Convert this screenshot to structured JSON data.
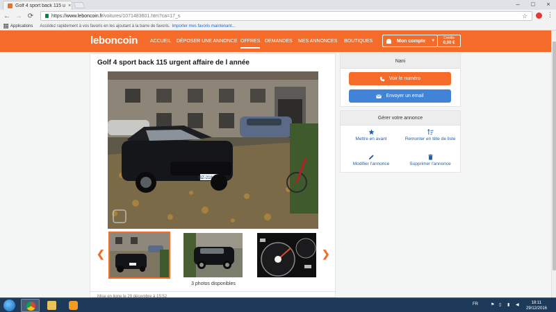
{
  "browser": {
    "tab_title": "Golf 4 sport back 115 ur",
    "tab_close": "×",
    "window_controls": [
      "–",
      "□",
      "×"
    ],
    "nav": {
      "back": "←",
      "forward": "→",
      "reload": "⟳",
      "home": "⌂"
    },
    "url_prefix": "https://",
    "url_host": "www.leboncoin.fr",
    "url_path": "/voitures/1071483601.htm?ca=17_s",
    "star": "☆",
    "menu": "⋮"
  },
  "bookmarks": {
    "apps_label": "Applications",
    "hint": "Accédez rapidement à vos favoris en les ajoutant à la barre de favoris.",
    "import_link": "Importer mes favoris maintenant..."
  },
  "site": {
    "logo": "leboncoin",
    "nav": [
      "Accueil",
      "Déposer une annonce",
      "Offres",
      "Demandes",
      "Mes annonces",
      "Boutiques"
    ],
    "active_nav": "Offres",
    "account_label": "Mon compte",
    "credits_label": "Crédits",
    "credits_value": "0,00 €",
    "brand_color": "#f56b2a"
  },
  "ad": {
    "title": "Golf 4 sport back 115 urgent affaire de l année",
    "photo_count": "3 photos disponibles",
    "posted_text": "Mise en ligne le 29 décembre à 15:52",
    "prev_arrow": "❮",
    "next_arrow": "❯",
    "plate": "BZ-218-WH"
  },
  "seller_panel": {
    "name": "Nani",
    "call_button": "Voir le numéro",
    "email_button": "Envoyer un email"
  },
  "manage_panel": {
    "title": "Gérer votre annonce",
    "actions": {
      "highlight": "Mettre en avant",
      "bump": "Remonter en tête de liste",
      "edit": "Modifier l'annonce",
      "delete": "Supprimer l'annonce"
    }
  },
  "taskbar": {
    "language": "FR",
    "time": "18:11",
    "date": "29/12/2016"
  }
}
